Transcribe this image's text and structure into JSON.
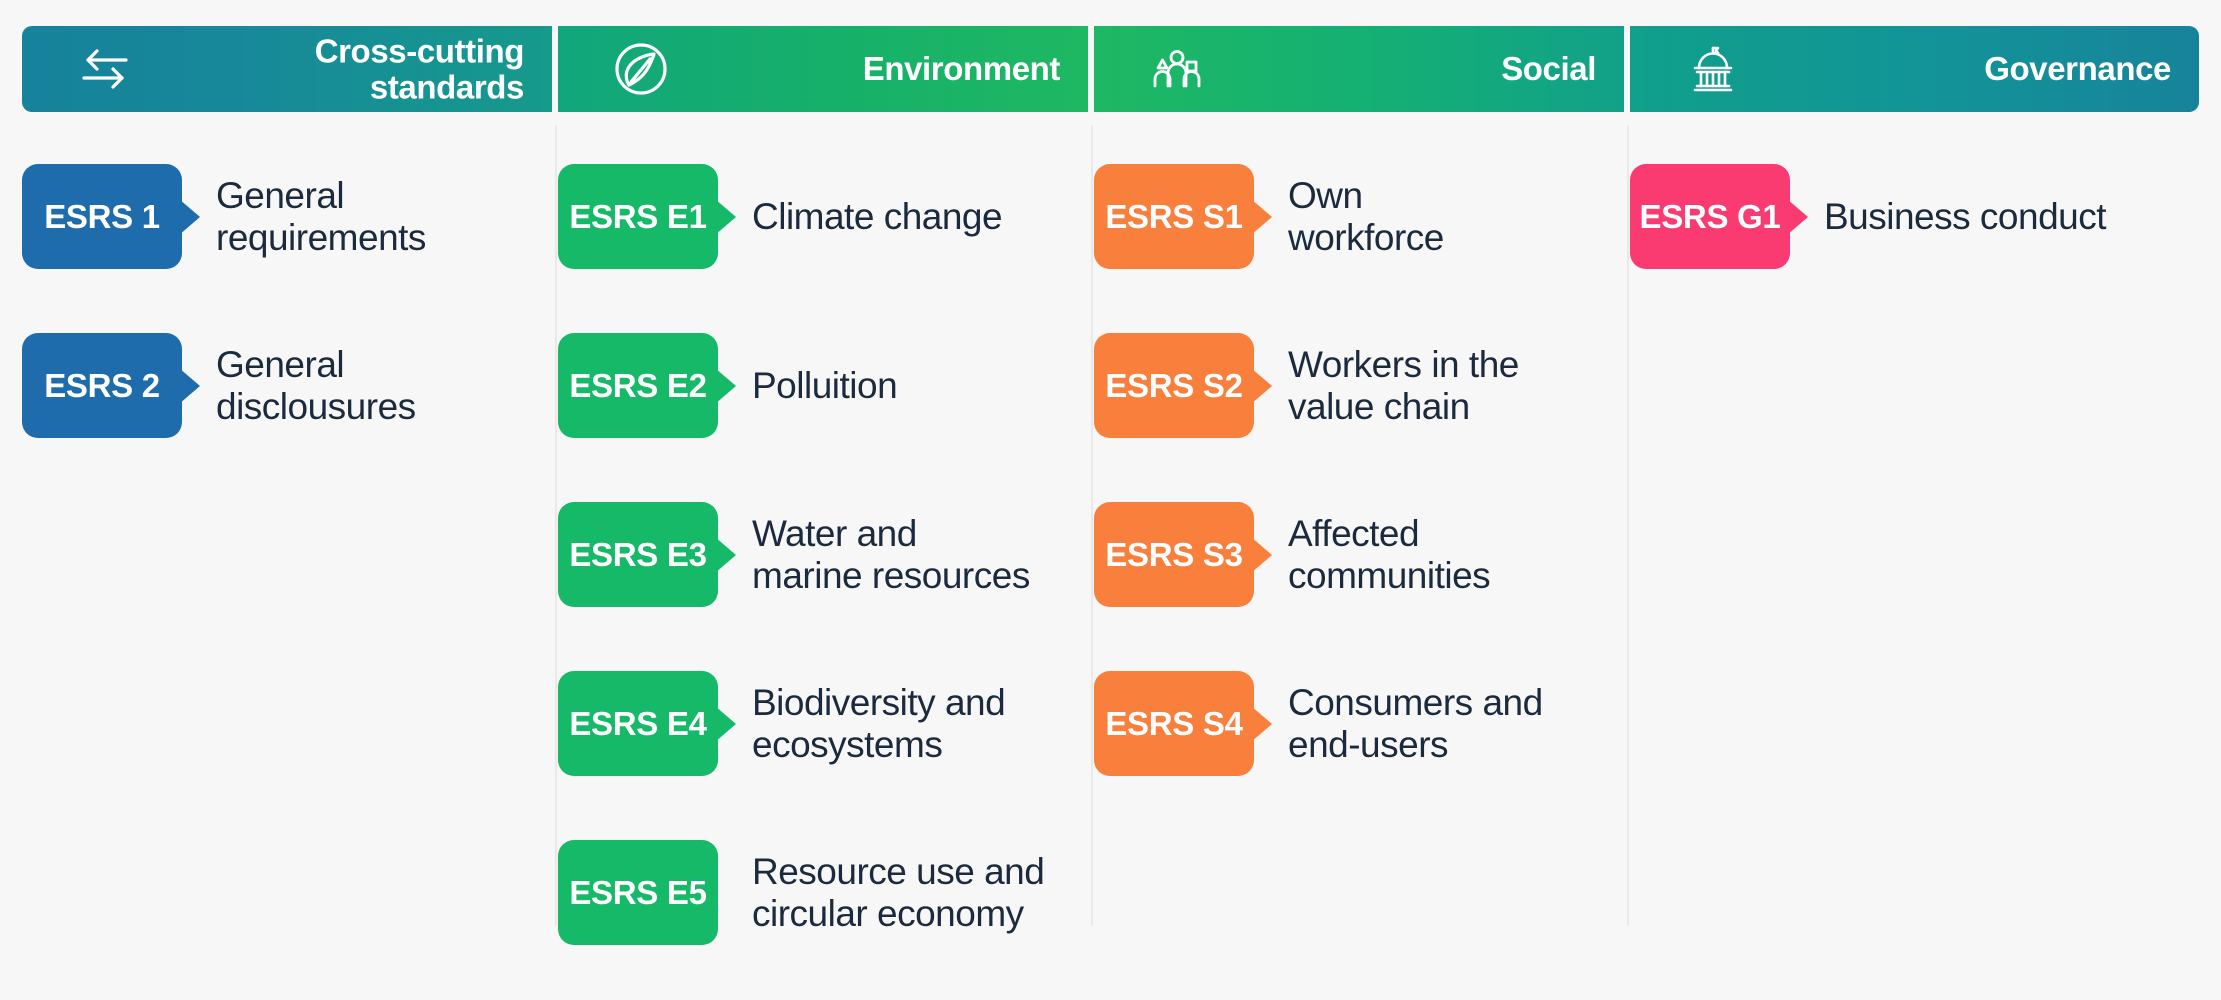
{
  "colors": {
    "page_background": "#f7f7f7",
    "header_teal": "#17839b",
    "header_green": "#1eb863",
    "cross_cutting_badge": "#1e6cab",
    "environment_badge": "#16b968",
    "social_badge": "#f87f3c",
    "governance_badge": "#f93b72",
    "label_text": "#1b2a3d"
  },
  "columns": [
    {
      "id": "cross-cutting",
      "header": {
        "title": "Cross-cutting\nstandards",
        "icon": "bidirectional-arrows-icon"
      },
      "badge_color": "#1e6cab",
      "items": [
        {
          "code": "ESRS 1",
          "label": "General\nrequirements",
          "tail": true
        },
        {
          "code": "ESRS 2",
          "label": "General\ndisclousures",
          "tail": true
        }
      ]
    },
    {
      "id": "environment",
      "header": {
        "title": "Environment",
        "icon": "leaf-in-circle-icon"
      },
      "badge_color": "#16b968",
      "items": [
        {
          "code": "ESRS E1",
          "label": "Climate change",
          "tail": true
        },
        {
          "code": "ESRS E2",
          "label": "Polluition",
          "tail": true
        },
        {
          "code": "ESRS E3",
          "label": "Water and\nmarine resources",
          "tail": true
        },
        {
          "code": "ESRS E4",
          "label": "Biodiversity and\necosystems",
          "tail": true
        },
        {
          "code": "ESRS E5",
          "label": "Resource use and\ncircular economy",
          "tail": false
        }
      ]
    },
    {
      "id": "social",
      "header": {
        "title": "Social",
        "icon": "three-people-icon"
      },
      "badge_color": "#f87f3c",
      "items": [
        {
          "code": "ESRS S1",
          "label": "Own\nworkforce",
          "tail": true
        },
        {
          "code": "ESRS S2",
          "label": "Workers in the\nvalue chain",
          "tail": true
        },
        {
          "code": "ESRS S3",
          "label": "Affected\ncommunities",
          "tail": true
        },
        {
          "code": "ESRS S4",
          "label": "Consumers and\nend-users",
          "tail": true
        }
      ]
    },
    {
      "id": "governance",
      "header": {
        "title": "Governance",
        "icon": "government-building-icon"
      },
      "badge_color": "#f93b72",
      "items": [
        {
          "code": "ESRS G1",
          "label": "Business conduct",
          "tail": true
        }
      ]
    }
  ]
}
